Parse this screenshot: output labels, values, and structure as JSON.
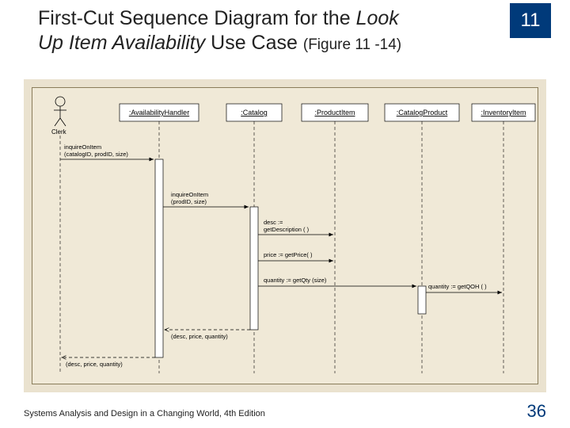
{
  "chapter_number": "11",
  "title_part1": "First-Cut Sequence Diagram for the ",
  "title_italic1": "Look",
  "title_italic2": "Up Item Availability",
  "title_part2": " Use Case ",
  "title_figure": "(Figure 11 -14)",
  "footer_left": "Systems Analysis and Design in a Changing World, 4th Edition",
  "slide_number": "36",
  "actor": {
    "label": "Clerk"
  },
  "objects": [
    {
      "name": ":AvailabilityHandler"
    },
    {
      "name": ":Catalog"
    },
    {
      "name": ":ProductItem"
    },
    {
      "name": ":CatalogProduct"
    },
    {
      "name": ":InventoryItem"
    }
  ],
  "messages": {
    "m1": {
      "text1": "inquireOnItem",
      "text2": "(catalogID, prodID, size)"
    },
    "m2": {
      "text1": "inquireOnItem",
      "text2": "(prodID, size)"
    },
    "m3": {
      "text": "desc :=",
      "text2": "getDescription ( )"
    },
    "m4": {
      "text": "price := getPrice( )"
    },
    "m5": {
      "text": "quantity := getQty (size)"
    },
    "m6": {
      "text": "quantity := getQOH ( )"
    },
    "r1": {
      "text": "(desc, price, quantity)"
    },
    "r2": {
      "text": "(desc, price, quantity)"
    }
  }
}
